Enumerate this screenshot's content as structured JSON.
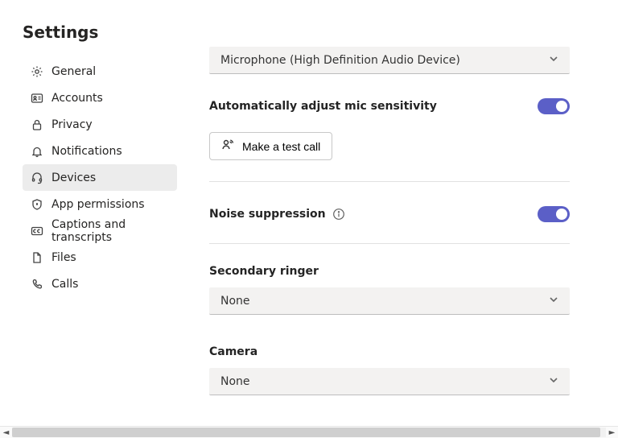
{
  "title": "Settings",
  "sidebar": {
    "items": [
      {
        "label": "General"
      },
      {
        "label": "Accounts"
      },
      {
        "label": "Privacy"
      },
      {
        "label": "Notifications"
      },
      {
        "label": "Devices"
      },
      {
        "label": "App permissions"
      },
      {
        "label": "Captions and transcripts"
      },
      {
        "label": "Files"
      },
      {
        "label": "Calls"
      }
    ]
  },
  "main": {
    "microphone_select": "Microphone (High Definition Audio Device)",
    "auto_adjust_label": "Automatically adjust mic sensitivity",
    "auto_adjust_on": true,
    "test_call_label": "Make a test call",
    "noise_suppression_label": "Noise suppression",
    "noise_suppression_on": true,
    "secondary_ringer_heading": "Secondary ringer",
    "secondary_ringer_value": "None",
    "camera_heading": "Camera",
    "camera_value": "None"
  },
  "colors": {
    "accent": "#5b5fc7"
  }
}
